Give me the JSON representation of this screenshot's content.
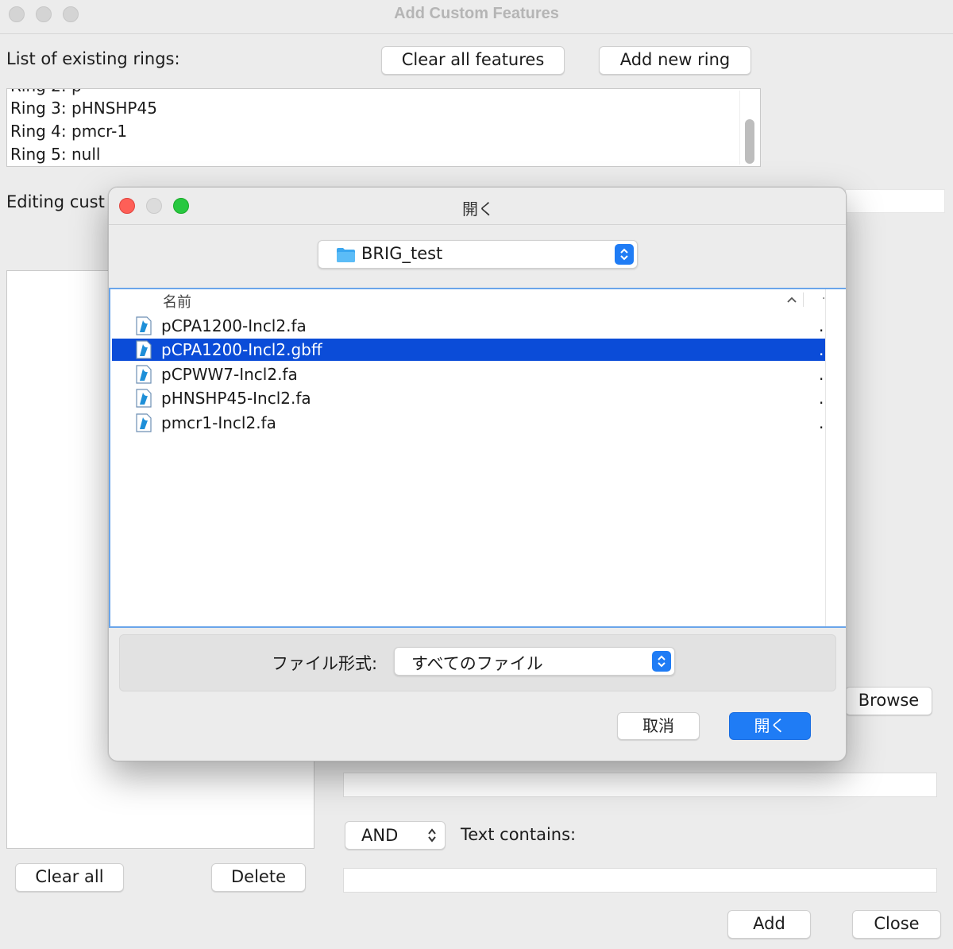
{
  "window": {
    "title": "Add Custom Features"
  },
  "rings": {
    "label": "List of existing rings:",
    "clear_all_features": "Clear all features",
    "add_new_ring": "Add new ring",
    "items": [
      "Ring 3: pHNSHP45",
      "Ring 4: pmcr-1",
      "Ring 5: null"
    ]
  },
  "editing": {
    "label": "Editing cust"
  },
  "buttons": {
    "browse": "Browse",
    "clear_all": "Clear all",
    "delete": "Delete",
    "add": "Add",
    "close": "Close"
  },
  "filter": {
    "operator": "AND",
    "text_contains_label": "Text contains:"
  },
  "dialog": {
    "title": "開く",
    "location": "BRIG_test",
    "column_name": "名前",
    "files": [
      {
        "name": "pCPA1200-Incl2.fa",
        "selected": false
      },
      {
        "name": "pCPA1200-Incl2.gbff",
        "selected": true
      },
      {
        "name": "pCPWW7-Incl2.fa",
        "selected": false
      },
      {
        "name": "pHNSHP45-Incl2.fa",
        "selected": false
      },
      {
        "name": "pmcr1-Incl2.fa",
        "selected": false
      }
    ],
    "file_format_label": "ファイル形式:",
    "file_format_value": "すべてのファイル",
    "cancel": "取消",
    "open": "開く",
    "colors": {
      "accent": "#1f7cf5",
      "selection": "#0b4cd8"
    }
  }
}
